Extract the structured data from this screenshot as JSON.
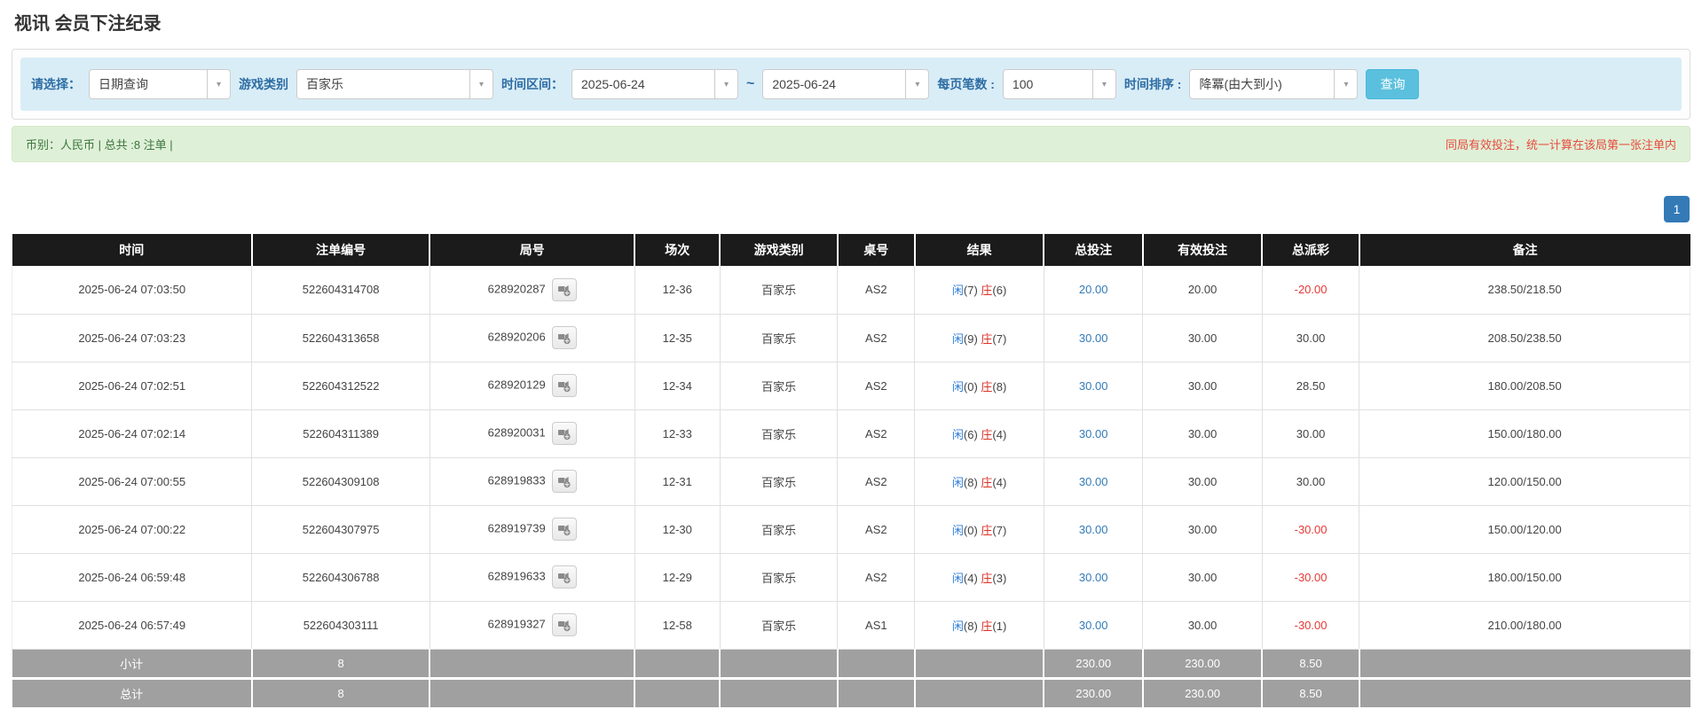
{
  "title": "视讯 会员下注纪录",
  "filter": {
    "query_label": "请选择：",
    "query_value": "日期查询",
    "game_label": "游戏类别",
    "game_value": "百家乐",
    "range_label": "时间区间：",
    "date_from": "2025-06-24",
    "range_separator": "~",
    "date_to": "2025-06-24",
    "page_size_label": "每页笔数 :",
    "page_size_value": "100",
    "sort_label": "时间排序 :",
    "sort_value": "降冪(由大到小)",
    "search_label": "查询"
  },
  "summary_bar": {
    "info": "币别：人民币 | 总共 :8 注单 |",
    "notice": "同局有效投注，统一计算在该局第一张注单内"
  },
  "pagination": {
    "page": "1"
  },
  "table": {
    "headers": [
      "时间",
      "注单编号",
      "局号",
      "场次",
      "游戏类别",
      "桌号",
      "结果",
      "总投注",
      "有效投注",
      "总派彩",
      "备注"
    ],
    "col_widths": [
      "14.3%",
      "10.6%",
      "12.2%",
      "5.1%",
      "7.0%",
      "4.6%",
      "7.7%",
      "5.9%",
      "7.1%",
      "5.8%",
      "19.7%"
    ],
    "rows": [
      {
        "time": "2025-06-24 07:03:50",
        "bet_no": "522604314708",
        "round_no": "628920287",
        "session": "12-36",
        "game": "百家乐",
        "table_no": "AS2",
        "result": {
          "player_label": "闲",
          "player": "(7)",
          "banker_label": "庄",
          "banker": "(6)"
        },
        "total_bet": "20.00",
        "valid_bet": "20.00",
        "payout": "-20.00",
        "remark": "238.50/218.50"
      },
      {
        "time": "2025-06-24 07:03:23",
        "bet_no": "522604313658",
        "round_no": "628920206",
        "session": "12-35",
        "game": "百家乐",
        "table_no": "AS2",
        "result": {
          "player_label": "闲",
          "player": "(9)",
          "banker_label": "庄",
          "banker": "(7)"
        },
        "total_bet": "30.00",
        "valid_bet": "30.00",
        "payout": "30.00",
        "remark": "208.50/238.50"
      },
      {
        "time": "2025-06-24 07:02:51",
        "bet_no": "522604312522",
        "round_no": "628920129",
        "session": "12-34",
        "game": "百家乐",
        "table_no": "AS2",
        "result": {
          "player_label": "闲",
          "player": "(0)",
          "banker_label": "庄",
          "banker": "(8)"
        },
        "total_bet": "30.00",
        "valid_bet": "30.00",
        "payout": "28.50",
        "remark": "180.00/208.50"
      },
      {
        "time": "2025-06-24 07:02:14",
        "bet_no": "522604311389",
        "round_no": "628920031",
        "session": "12-33",
        "game": "百家乐",
        "table_no": "AS2",
        "result": {
          "player_label": "闲",
          "player": "(6)",
          "banker_label": "庄",
          "banker": "(4)"
        },
        "total_bet": "30.00",
        "valid_bet": "30.00",
        "payout": "30.00",
        "remark": "150.00/180.00"
      },
      {
        "time": "2025-06-24 07:00:55",
        "bet_no": "522604309108",
        "round_no": "628919833",
        "session": "12-31",
        "game": "百家乐",
        "table_no": "AS2",
        "result": {
          "player_label": "闲",
          "player": "(8)",
          "banker_label": "庄",
          "banker": "(4)"
        },
        "total_bet": "30.00",
        "valid_bet": "30.00",
        "payout": "30.00",
        "remark": "120.00/150.00"
      },
      {
        "time": "2025-06-24 07:00:22",
        "bet_no": "522604307975",
        "round_no": "628919739",
        "session": "12-30",
        "game": "百家乐",
        "table_no": "AS2",
        "result": {
          "player_label": "闲",
          "player": "(0)",
          "banker_label": "庄",
          "banker": "(7)"
        },
        "total_bet": "30.00",
        "valid_bet": "30.00",
        "payout": "-30.00",
        "remark": "150.00/120.00"
      },
      {
        "time": "2025-06-24 06:59:48",
        "bet_no": "522604306788",
        "round_no": "628919633",
        "session": "12-29",
        "game": "百家乐",
        "table_no": "AS2",
        "result": {
          "player_label": "闲",
          "player": "(4)",
          "banker_label": "庄",
          "banker": "(3)"
        },
        "total_bet": "30.00",
        "valid_bet": "30.00",
        "payout": "-30.00",
        "remark": "180.00/150.00"
      },
      {
        "time": "2025-06-24 06:57:49",
        "bet_no": "522604303111",
        "round_no": "628919327",
        "session": "12-58",
        "game": "百家乐",
        "table_no": "AS1",
        "result": {
          "player_label": "闲",
          "player": "(8)",
          "banker_label": "庄",
          "banker": "(1)"
        },
        "total_bet": "30.00",
        "valid_bet": "30.00",
        "payout": "-30.00",
        "remark": "210.00/180.00"
      }
    ],
    "footer_rows": [
      {
        "label": "小计",
        "count": "8",
        "total_bet": "230.00",
        "valid_bet": "230.00",
        "payout": "8.50"
      },
      {
        "label": "总计",
        "count": "8",
        "total_bet": "230.00",
        "valid_bet": "230.00",
        "payout": "8.50"
      }
    ]
  },
  "icons": {
    "select_caret": "▾",
    "round_video": "video-icon"
  },
  "colors": {
    "filter_bar_bg": "#d9edf7",
    "label_blue": "#2e6da4",
    "search_btn_bg": "#5bc0de",
    "success_bg": "#dff0d8",
    "success_text": "#3c763d",
    "notice_red": "#e74c3c",
    "pagination_blue": "#337ab7",
    "table_header_bg": "#1b1b1b",
    "footer_bg": "#a0a0a0",
    "amount_blue": "#337ab7",
    "player_blue": "#2f7ed8",
    "banker_red": "#d9342b",
    "negative_red": "#e53935"
  }
}
